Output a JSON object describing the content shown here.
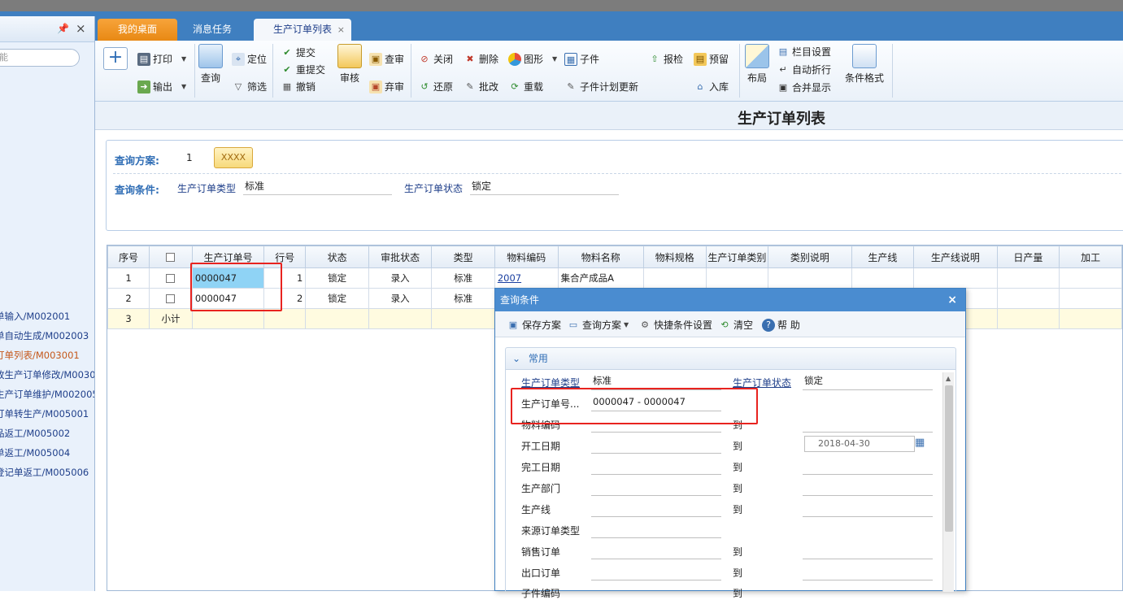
{
  "sidebar": {
    "search_placeholder": "能",
    "items": [
      {
        "label": "单输入/M002001",
        "active": false
      },
      {
        "label": "单自动生成/M002003",
        "active": false
      },
      {
        "label": "订单列表/M003001",
        "active": true
      },
      {
        "label": "改生产订单修改/M00300",
        "active": false
      },
      {
        "label": "生产订单维护/M002005",
        "active": false
      },
      {
        "label": "订单转生产/M005001",
        "active": false
      },
      {
        "label": "品返工/M005002",
        "active": false
      },
      {
        "label": "单返工/M005004",
        "active": false
      },
      {
        "label": "登记单返工/M005006",
        "active": false
      }
    ]
  },
  "tabs": [
    {
      "label": "我的桌面"
    },
    {
      "label": "消息任务"
    },
    {
      "label": "生产订单列表",
      "close": "×"
    }
  ],
  "toolbar": {
    "print": "打印",
    "export": "输出",
    "query": "查询",
    "locate": "定位",
    "filter": "筛选",
    "submit": "提交",
    "resubmit": "重提交",
    "revoke": "撤销",
    "audit": "审核",
    "check": "查审",
    "abandon": "弃审",
    "close": "关闭",
    "restore": "还原",
    "delete": "删除",
    "approve": "批改",
    "chart": "图形",
    "reload": "重载",
    "child": "子件",
    "child_plan_update": "子件计划更新",
    "inspect": "报检",
    "reserve": "预留",
    "stockin": "入库",
    "layout": "布局",
    "column_settings": "栏目设置",
    "auto_wrap": "自动折行",
    "merge_display": "合并显示",
    "cond_format": "条件格式"
  },
  "page_title": "生产订单列表",
  "query": {
    "plan_label": "查询方案:",
    "plan_value": "1",
    "plan_button": "XXXX",
    "cond_label": "查询条件:",
    "type_label": "生产订单类型",
    "type_value": "标准",
    "status_label": "生产订单状态",
    "status_value": "锁定"
  },
  "grid": {
    "columns": [
      "序号",
      "",
      "生产订单号",
      "行号",
      "状态",
      "审批状态",
      "类型",
      "物料编码",
      "物料名称",
      "物料规格",
      "生产订单类别",
      "类别说明",
      "生产线",
      "生产线说明",
      "日产量",
      "加工"
    ],
    "rows": [
      {
        "seq": "1",
        "order_no": "0000047",
        "line": "1",
        "status": "锁定",
        "approval": "录入",
        "type": "标准",
        "material_code": "2007",
        "material_name": "集合产成品A"
      },
      {
        "seq": "2",
        "order_no": "0000047",
        "line": "2",
        "status": "锁定",
        "approval": "录入",
        "type": "标准",
        "material_code": "",
        "material_name": ""
      }
    ],
    "subtotal": {
      "seq": "3",
      "label": "小计"
    }
  },
  "dialog": {
    "title": "查询条件",
    "close": "×",
    "save_plan": "保存方案",
    "query_plan": "查询方案",
    "quick_settings": "快捷条件设置",
    "clear": "清空",
    "help": "帮 助",
    "section": "常用",
    "to": "到",
    "fields": {
      "type_label": "生产订单类型",
      "type_value": "标准",
      "status_label": "生产订单状态",
      "status_value": "锁定",
      "order_no_label": "生产订单号...",
      "order_no_value": "0000047 - 0000047",
      "material_code": "物料编码",
      "start_date": "开工日期",
      "start_date_to": "2018-04-30",
      "finish_date": "完工日期",
      "dept": "生产部门",
      "line": "生产线",
      "source_type": "来源订单类型",
      "sales_order": "销售订单",
      "export_order": "出口订单",
      "child_code": "子件编码"
    }
  }
}
